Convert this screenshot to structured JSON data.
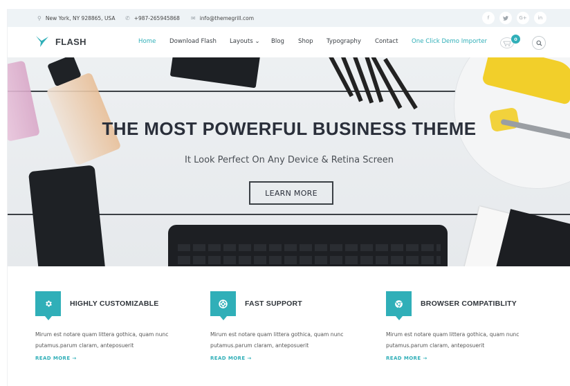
{
  "topbar": {
    "address": "New York, NY 928865, USA",
    "phone": "+987-265945868",
    "email": "info@themegrill.com",
    "social": [
      {
        "name": "facebook",
        "glyph": "f"
      },
      {
        "name": "twitter",
        "glyph": "ᵛ"
      },
      {
        "name": "google-plus",
        "glyph": "G+"
      },
      {
        "name": "linkedin",
        "glyph": "in"
      }
    ]
  },
  "header": {
    "brand": "FLASH",
    "nav": [
      {
        "label": "Home",
        "state": "active"
      },
      {
        "label": "Download Flash"
      },
      {
        "label": "Layouts ⌄"
      },
      {
        "label": "Blog"
      },
      {
        "label": "Shop"
      },
      {
        "label": "Typography"
      },
      {
        "label": "Contact"
      },
      {
        "label": "One Click Demo Importer",
        "state": "accent"
      }
    ],
    "cart_count": "0"
  },
  "hero": {
    "title": "THE MOST POWERFUL BUSINESS THEME",
    "subtitle": "It Look Perfect On Any Device & Retina Screen",
    "button": "LEARN MORE"
  },
  "features": [
    {
      "icon": "gear-icon",
      "title": "HIGHLY CUSTOMIZABLE",
      "text": "Mirum est notare quam littera gothica, quam nunc putamus.parum claram, anteposuerit",
      "link": "READ MORE →"
    },
    {
      "icon": "life-ring-icon",
      "title": "FAST SUPPORT",
      "text": "Mirum est notare quam littera gothica, quam nunc putamus.parum claram, anteposuerit",
      "link": "READ MORE →"
    },
    {
      "icon": "chrome-icon",
      "title": "BROWSER COMPATIBLITY",
      "text": "Mirum est notare quam littera gothica, quam nunc putamus.parum claram, anteposuerit",
      "link": "READ MORE →"
    }
  ],
  "colors": {
    "accent": "#30afb8",
    "topbar_bg": "#eef3f6",
    "heading": "#2a2f3a"
  }
}
